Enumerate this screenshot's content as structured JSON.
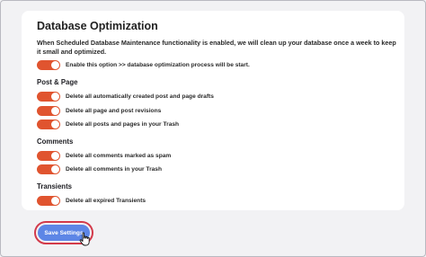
{
  "panel": {
    "title": "Database Optimization",
    "description": "When Scheduled Database Maintenance functionality is enabled, we will clean up your database once a week to keep it small and optimized.",
    "main_toggle": {
      "label": "Enable this option >> database optimization process will be start.",
      "on": true
    }
  },
  "sections": {
    "post_page": {
      "title": "Post & Page",
      "items": [
        {
          "label": "Delete all automatically created post and page drafts",
          "on": true
        },
        {
          "label": "Delete all page and post revisions",
          "on": true
        },
        {
          "label": "Delete all posts and pages in your Trash",
          "on": true
        }
      ]
    },
    "comments": {
      "title": "Comments",
      "items": [
        {
          "label": "Delete all comments marked as spam",
          "on": true
        },
        {
          "label": "Delete all comments in your Trash",
          "on": true
        }
      ]
    },
    "transients": {
      "title": "Transients",
      "items": [
        {
          "label": "Delete all expired Transients",
          "on": true
        }
      ]
    }
  },
  "actions": {
    "save_label": "Save Settings"
  },
  "colors": {
    "toggle_on": "#e0542f",
    "button": "#5d86e6",
    "button_outline": "#d33a4a"
  },
  "icons": {
    "toggle": "toggle-switch-icon",
    "cursor": "hand-pointer-icon"
  }
}
